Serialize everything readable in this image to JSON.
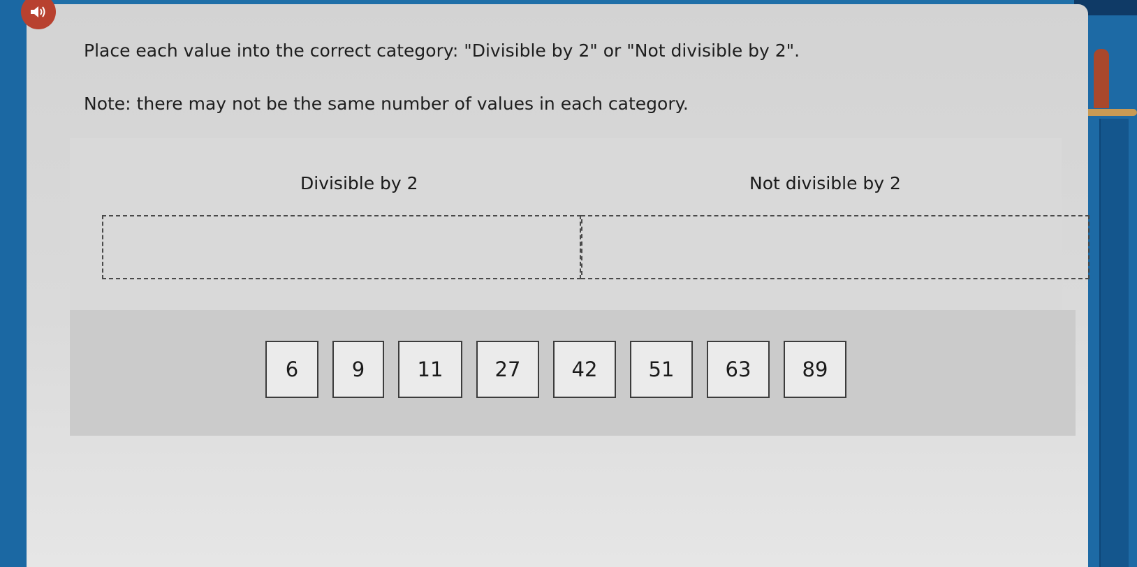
{
  "instructions": {
    "prompt": "Place each value into the correct category: \"Divisible by 2\" or \"Not divisible by 2\".",
    "note": "Note: there may not be the same number of values in each category."
  },
  "icons": {
    "audio": "speaker-icon"
  },
  "categories": [
    {
      "title": "Divisible by 2"
    },
    {
      "title": "Not divisible by 2"
    }
  ],
  "values": [
    "6",
    "9",
    "11",
    "27",
    "42",
    "51",
    "63",
    "89"
  ],
  "colors": {
    "page_background": "#1f6fa8",
    "card": "#d3d3d3",
    "speaker_button": "#b8412f",
    "tile_border": "#3c3c3c"
  }
}
